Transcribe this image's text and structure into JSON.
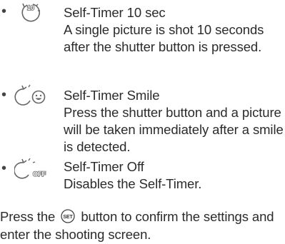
{
  "items": [
    {
      "icon": "self-timer-10sec-icon",
      "icon_text": "10",
      "title": "Self-Timer 10 sec",
      "description": "A single picture is shot 10 seconds after the shutter button is pressed."
    },
    {
      "icon": "self-timer-smile-icon",
      "title": "Self-Timer Smile",
      "description": "Press the shutter button and a picture will be taken immediately after a smile is detected."
    },
    {
      "icon": "self-timer-off-icon",
      "icon_text": "OFF",
      "title": "Self-Timer Off",
      "description": "Disables the Self-Timer."
    }
  ],
  "footer": {
    "before": "Press the",
    "button_icon": "set-button-icon",
    "button_text": "SET",
    "after": "button to confirm the settings and enter the shooting screen."
  },
  "bullet": "•"
}
